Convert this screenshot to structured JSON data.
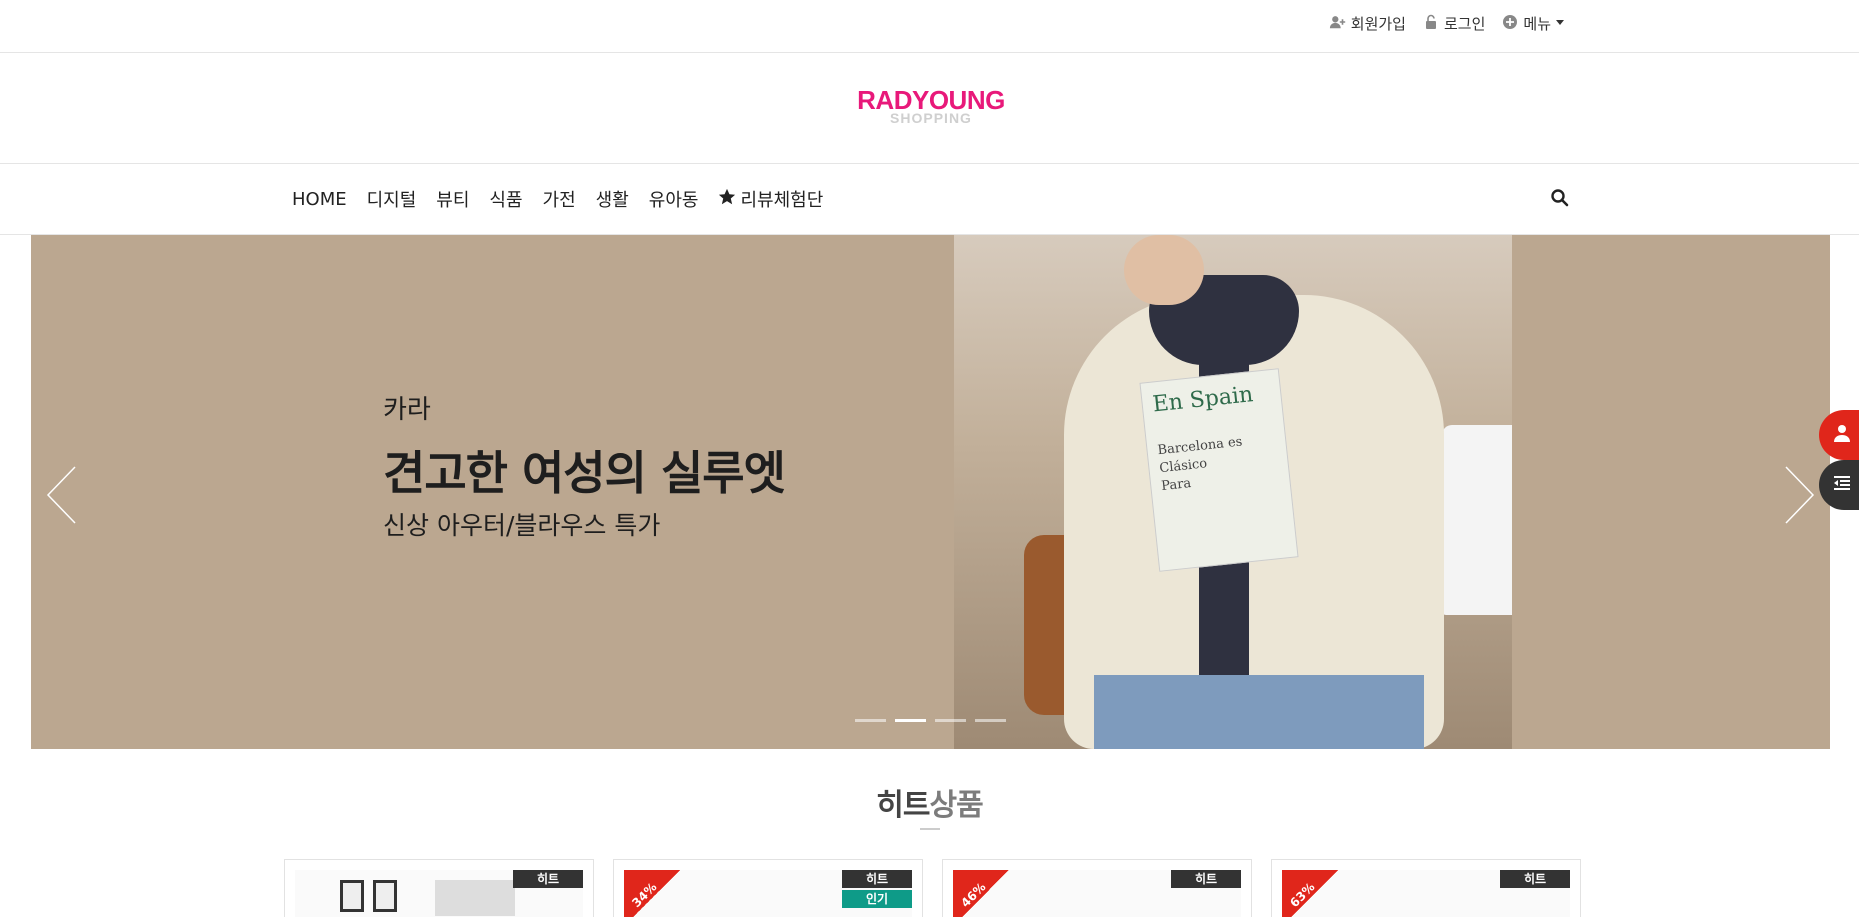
{
  "topbar": {
    "signup": "회원가입",
    "login": "로그인",
    "menu": "메뉴"
  },
  "logo": {
    "main": "RADYOUNG",
    "sub": "SHOPPING",
    "color": "#e8197a"
  },
  "nav": {
    "items": [
      "HOME",
      "디지털",
      "뷰티",
      "식품",
      "가전",
      "생활",
      "유아동"
    ],
    "review": "리뷰체험단"
  },
  "banner": {
    "small": "카라",
    "headline": "견고한 여성의 실루엣",
    "desc": "신상 아우터/블라우스 특가",
    "background": "#bba790",
    "photo_book_title": "En Spain",
    "photo_book_text": [
      "Barcelona es",
      "Clásico",
      "Para"
    ],
    "active_slide": 2,
    "slide_count": 4
  },
  "section": {
    "title_part1": "히트",
    "title_part2": "상품"
  },
  "products": [
    {
      "discount": "",
      "badges": [
        "히트"
      ]
    },
    {
      "discount": "34%",
      "badges": [
        "히트",
        "인기"
      ]
    },
    {
      "discount": "46%",
      "badges": [
        "히트"
      ]
    },
    {
      "discount": "63%",
      "badges": [
        "히트"
      ]
    }
  ],
  "colors": {
    "accent": "#e0261b",
    "popular_badge": "#0e9b88",
    "hit_badge": "#333333"
  }
}
